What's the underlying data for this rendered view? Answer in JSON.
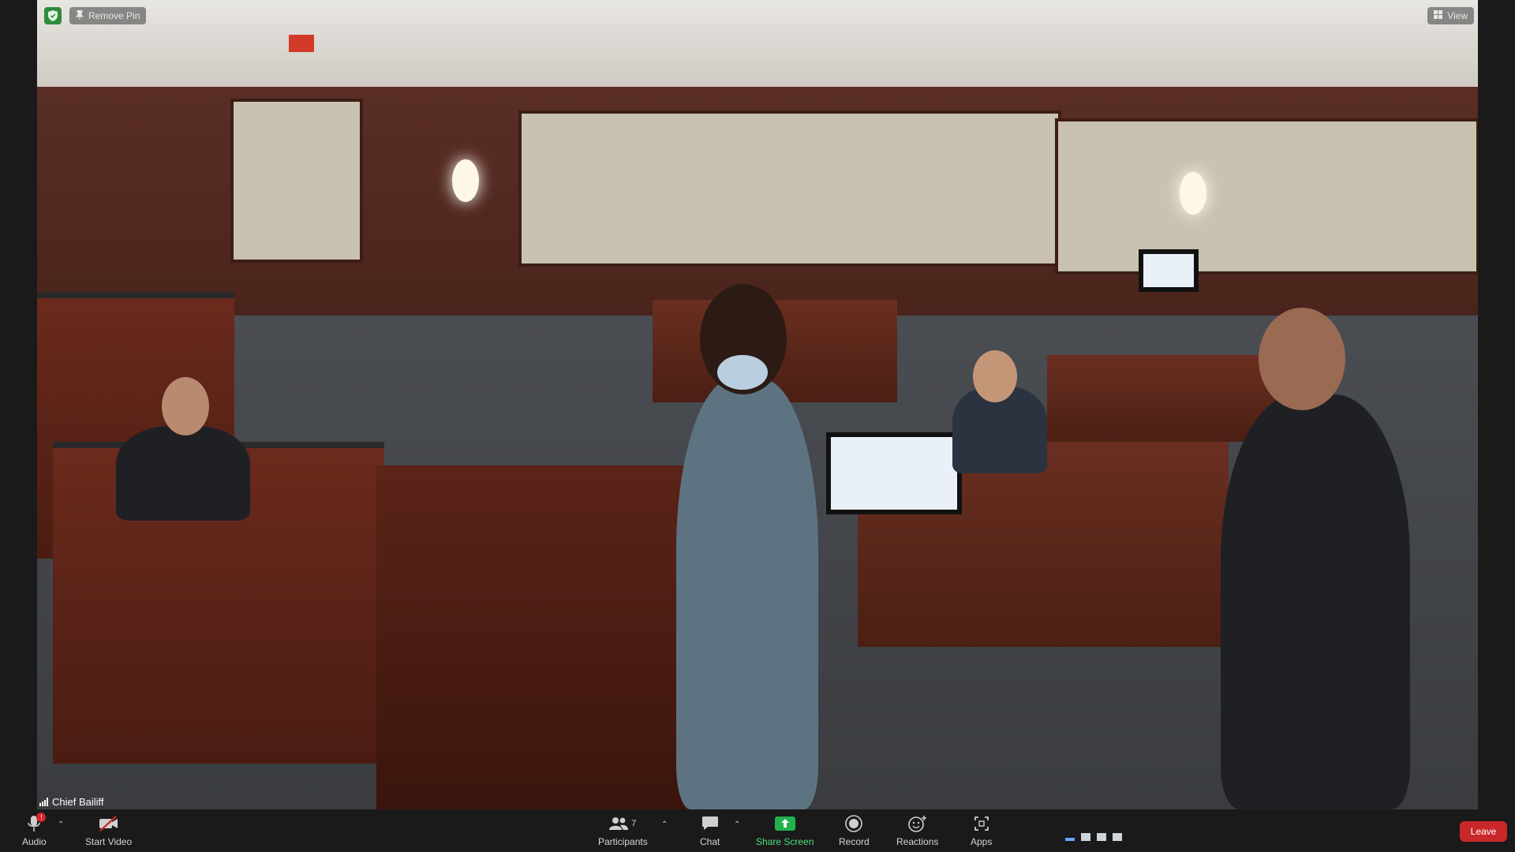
{
  "top": {
    "remove_pin_label": "Remove Pin",
    "view_label": "View"
  },
  "video": {
    "speaker_name": "Chief Bailiff"
  },
  "toolbar": {
    "audio_label": "Audio",
    "audio_alert": "!",
    "start_video_label": "Start Video",
    "participants_label": "Participants",
    "participants_count": "7",
    "chat_label": "Chat",
    "share_screen_label": "Share Screen",
    "record_label": "Record",
    "reactions_label": "Reactions",
    "apps_label": "Apps",
    "leave_label": "Leave"
  },
  "colors": {
    "toolbar_bg": "#1a1a1a",
    "share_green": "#23b14d",
    "leave_red": "#c8282a",
    "shield_green": "#2f8a3b"
  }
}
